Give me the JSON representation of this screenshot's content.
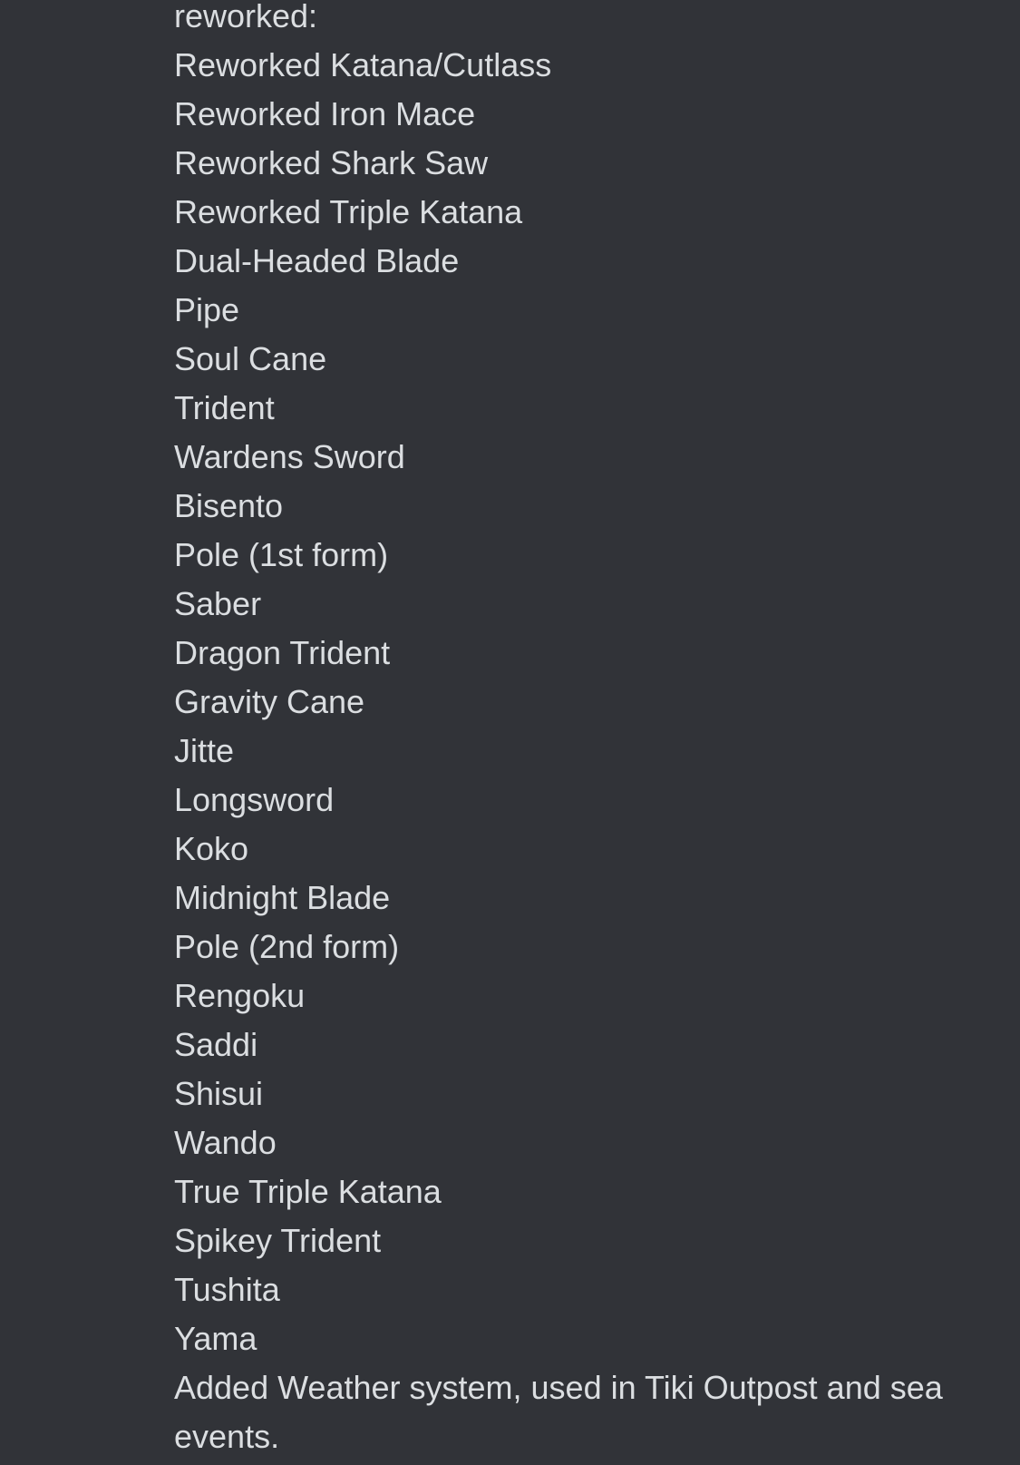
{
  "message": {
    "intro": "reworked:",
    "items": [
      "Reworked Katana/Cutlass",
      "Reworked Iron Mace",
      "Reworked Shark Saw",
      "Reworked Triple Katana",
      "Dual-Headed Blade",
      "Pipe",
      "Soul Cane",
      "Trident",
      "Wardens Sword",
      "Bisento",
      "Pole (1st form)",
      "Saber",
      "Dragon Trident",
      "Gravity Cane",
      "Jitte",
      "Longsword",
      "Koko",
      "Midnight Blade",
      "Pole (2nd form)",
      "Rengoku",
      "Saddi",
      "Shisui",
      "Wando",
      "True Triple Katana",
      "Spikey Trident",
      "Tushita",
      "Yama"
    ],
    "footer": "Added Weather system, used in Tiki Outpost and sea events."
  },
  "colors": {
    "background": "#313338",
    "text": "#dbdee1"
  }
}
